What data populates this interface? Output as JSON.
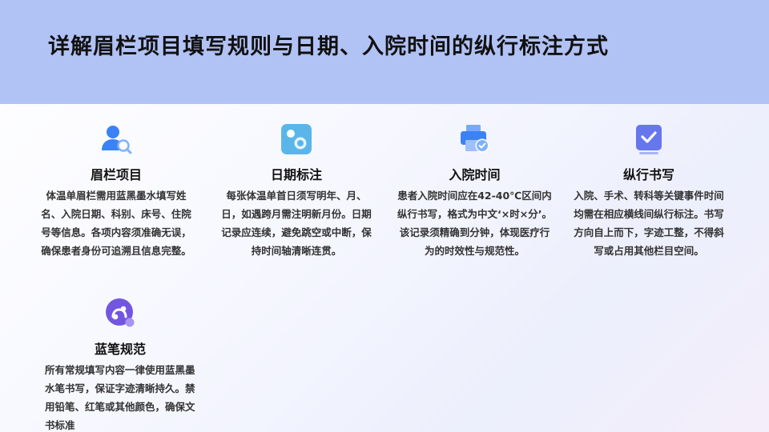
{
  "page": {
    "title": "详解眉栏项目填写规则与日期、入院时间的纵行标注方式"
  },
  "colors": {
    "header_bg": "#b1c2f5",
    "icon_blue": "#3b82f6",
    "icon_cyan": "#5ab6e8",
    "icon_indigo": "#6677ee",
    "icon_purple": "#7356e0"
  },
  "cards": [
    {
      "icon": "user-search-icon",
      "title": "眉栏项目",
      "text": "体温单眉栏需用蓝黑墨水填写姓名、入院日期、科别、床号、住院号等信息。各项内容须准确无误，确保患者身份可追溯且信息完整。"
    },
    {
      "icon": "bubbles-icon",
      "title": "日期标注",
      "text": "每张体温单首日须写明年、月、日，如遇跨月需注明新月份。日期记录应连续，避免跳空或中断，保持时间轴清晰连贯。"
    },
    {
      "icon": "printer-check-icon",
      "title": "入院时间",
      "text": "患者入院时间应在42-40℃区间内纵行书写，格式为中文‘×时×分’。该记录须精确到分钟，体现医疗行为的时效性与规范性。"
    },
    {
      "icon": "checkbox-icon",
      "title": "纵行书写",
      "text": "入院、手术、转科等关键事件时间均需在相应横线间纵行标注。书写方向自上而下，字迹工整，不得斜写或占用其他栏目空间。"
    },
    {
      "icon": "link-icon",
      "title": "蓝笔规范",
      "text": "所有常规填写内容一律使用蓝黑墨水笔书写，保证字迹清晰持久。禁用铅笔、红笔或其他颜色，确保文书标准"
    }
  ]
}
